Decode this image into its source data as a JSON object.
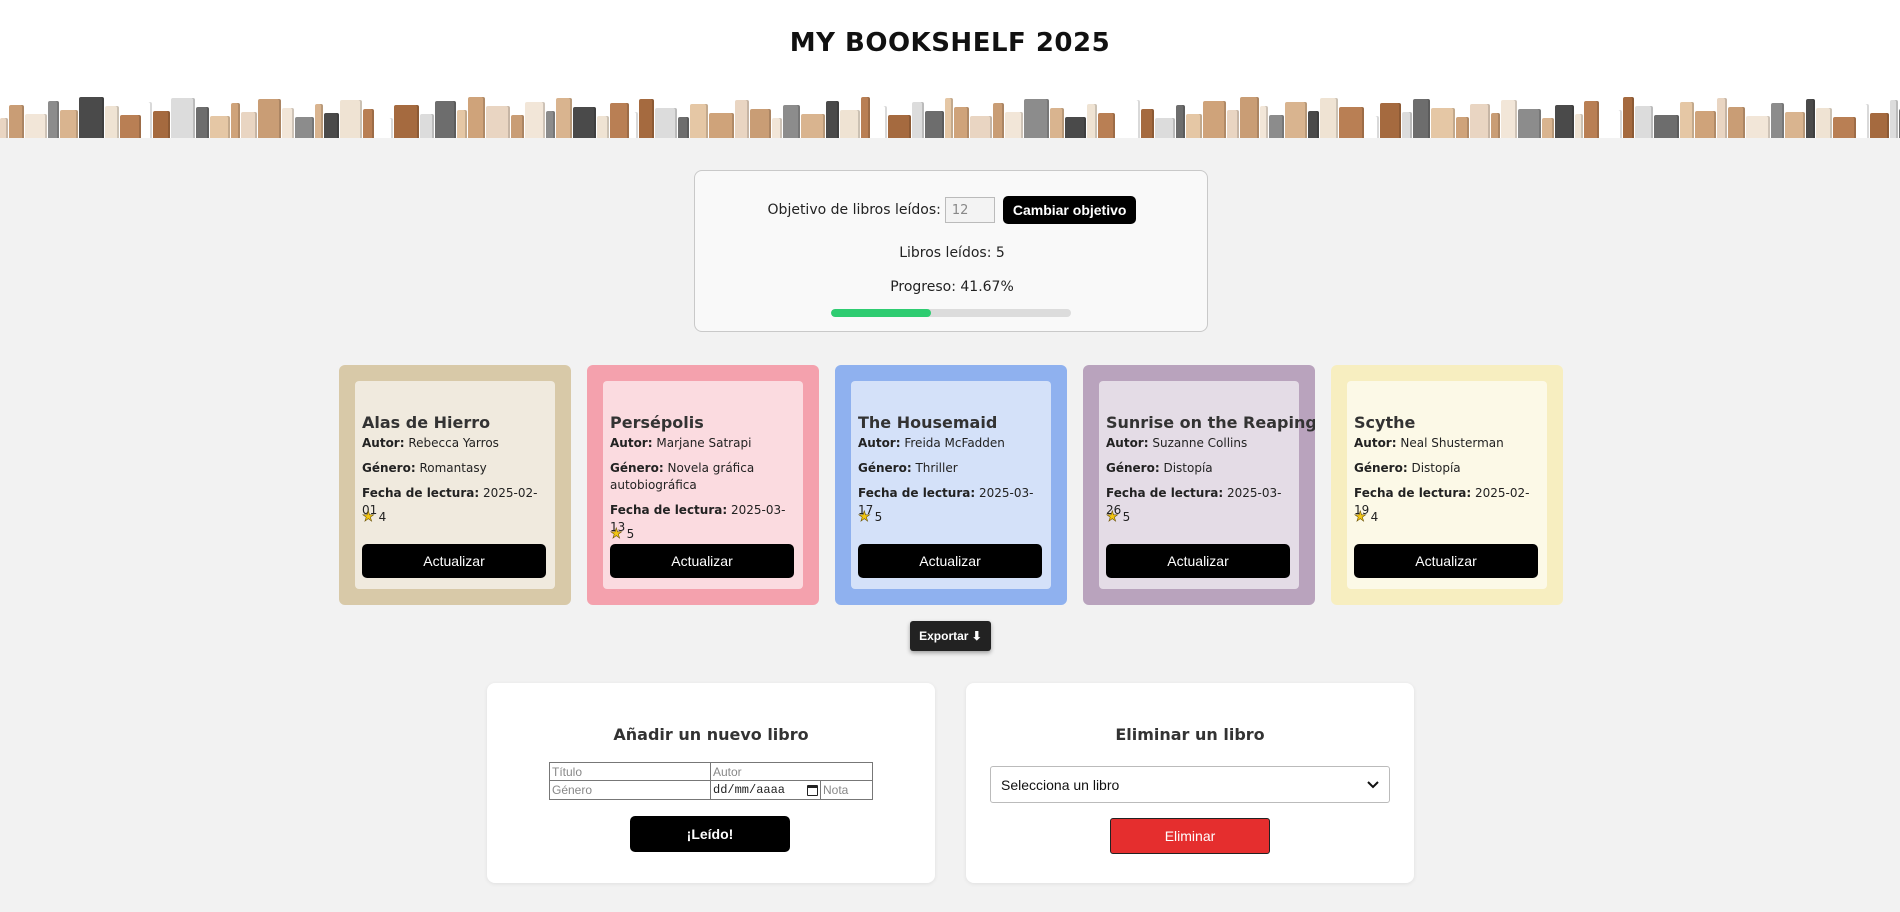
{
  "header": {
    "title": "MY BOOKSHELF 2025"
  },
  "goal": {
    "label": "Objetivo de libros leídos:",
    "input_value": "12",
    "change_button": "Cambiar objetivo",
    "read_text": "Libros leídos: 5",
    "progress_text": "Progreso: 41.67%",
    "progress_fraction": 0.4167,
    "progress_color": "#2ecc71"
  },
  "books": [
    {
      "title": "Alas de Hierro",
      "author_label": "Autor:",
      "author": "Rebecca Yarros",
      "genre_label": "Género:",
      "genre": "Romantasy",
      "date_label": "Fecha de lectura:",
      "date": "2025-02-01",
      "rating": "4",
      "button": "Actualizar",
      "background": "#d8c9a8"
    },
    {
      "title": "Persépolis",
      "author_label": "Autor:",
      "author": "Marjane Satrapi",
      "genre_label": "Género:",
      "genre": "Novela gráfica autobiográfica",
      "date_label": "Fecha de lectura:",
      "date": "2025-03-13",
      "rating": "5",
      "button": "Actualizar",
      "background": "#f4a1ad"
    },
    {
      "title": "The Housemaid",
      "author_label": "Autor:",
      "author": "Freida McFadden",
      "genre_label": "Género:",
      "genre": "Thriller",
      "date_label": "Fecha de lectura:",
      "date": "2025-03-17",
      "rating": "5",
      "button": "Actualizar",
      "background": "#8fb1ef"
    },
    {
      "title": "Sunrise on the Reaping",
      "author_label": "Autor:",
      "author": "Suzanne Collins",
      "genre_label": "Género:",
      "genre": "Distopía",
      "date_label": "Fecha de lectura:",
      "date": "2025-03-26",
      "rating": "5",
      "button": "Actualizar",
      "background": "#b9a3bd"
    },
    {
      "title": "Scythe",
      "author_label": "Autor:",
      "author": "Neal Shusterman",
      "genre_label": "Género:",
      "genre": "Distopía",
      "date_label": "Fecha de lectura:",
      "date": "2025-02-19",
      "rating": "4",
      "button": "Actualizar",
      "background": "#f7eec0"
    }
  ],
  "export": {
    "label": "Exportar ⬇"
  },
  "add_form": {
    "title": "Añadir un nuevo libro",
    "title_placeholder": "Título",
    "author_placeholder": "Autor",
    "genre_placeholder": "Género",
    "date_placeholder": "dd/mm/aaaa",
    "note_placeholder": "Nota",
    "submit": "¡Leído!"
  },
  "delete_form": {
    "title": "Eliminar un libro",
    "select_value": "Selecciona un libro",
    "submit": "Eliminar",
    "button_color": "#e52e2e"
  }
}
